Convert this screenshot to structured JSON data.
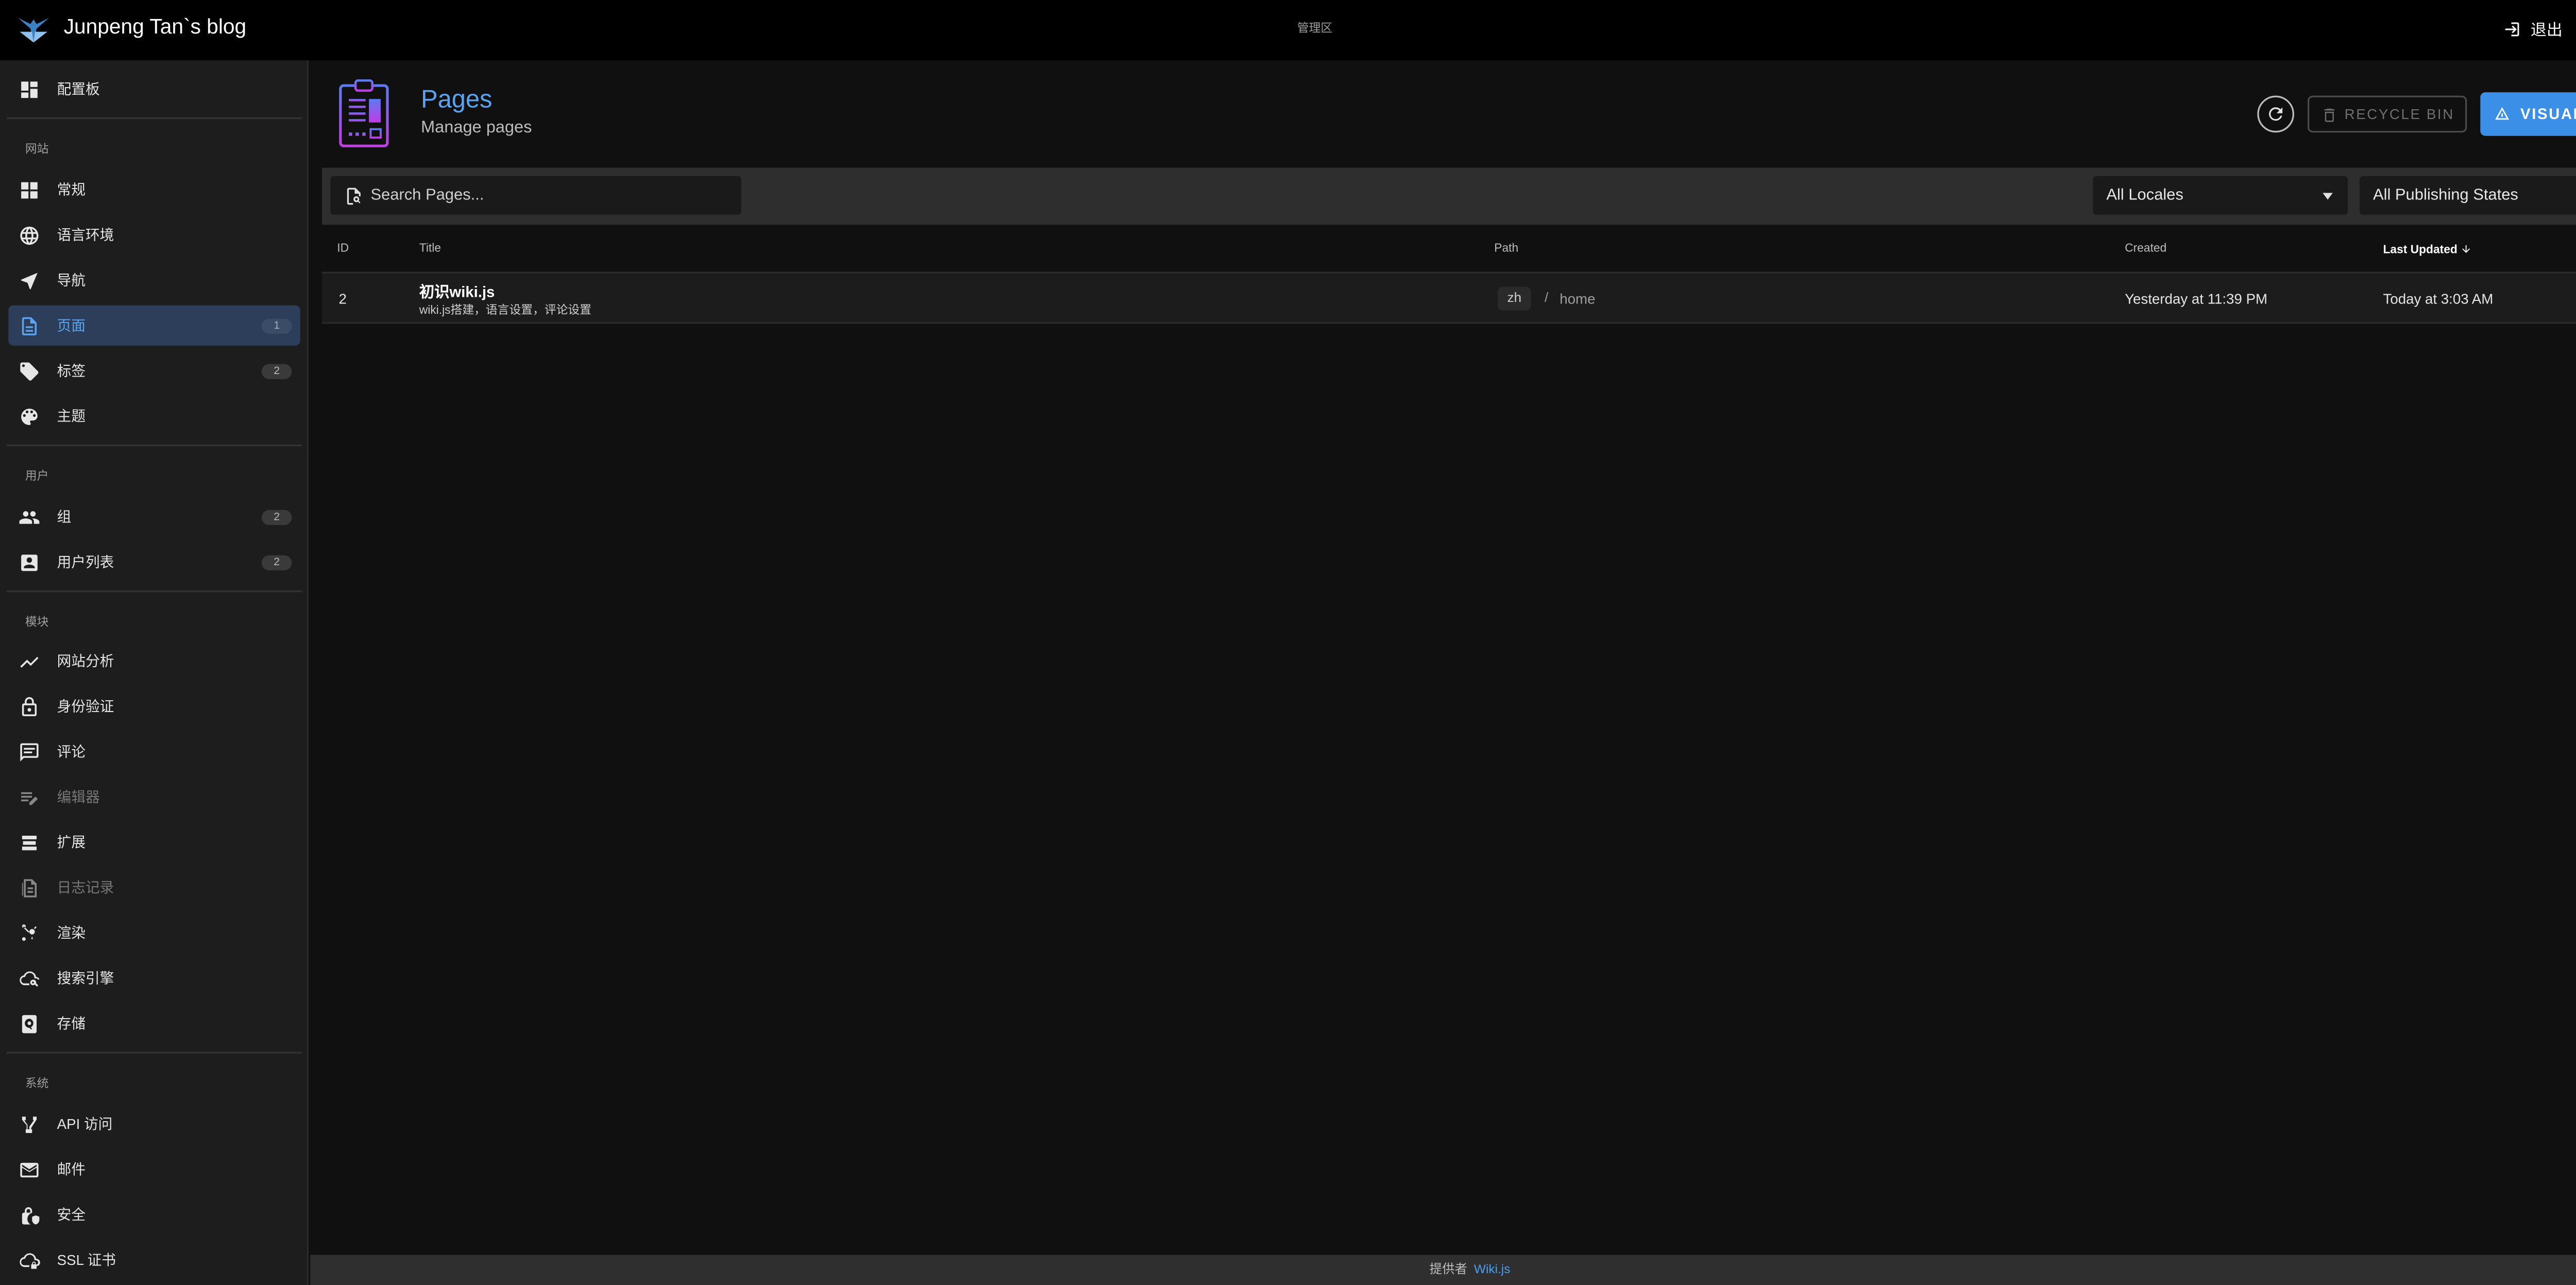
{
  "header": {
    "brand": "Junpeng Tan`s blog",
    "admin_area": "管理区",
    "logout": "退出"
  },
  "sidebar": {
    "dashboard": "配置板",
    "sections": {
      "site": "网站",
      "users": "用户",
      "modules": "模块",
      "system": "系统"
    },
    "items": [
      {
        "label": "常规",
        "icon": "dashboard-icon"
      },
      {
        "label": "语言环境",
        "icon": "globe-icon"
      },
      {
        "label": "导航",
        "icon": "navigation-icon"
      },
      {
        "label": "页面",
        "icon": "page-icon",
        "count": "1"
      },
      {
        "label": "标签",
        "icon": "tags-icon",
        "count": "2"
      },
      {
        "label": "主题",
        "icon": "palette-icon"
      },
      {
        "label": "组",
        "icon": "group-icon",
        "count": "2"
      },
      {
        "label": "用户列表",
        "icon": "user-list-icon",
        "count": "2"
      },
      {
        "label": "网站分析",
        "icon": "analytics-icon"
      },
      {
        "label": "身份验证",
        "icon": "lock-icon"
      },
      {
        "label": "评论",
        "icon": "comment-icon"
      },
      {
        "label": "编辑器",
        "icon": "editor-icon"
      },
      {
        "label": "扩展",
        "icon": "extension-icon"
      },
      {
        "label": "日志记录",
        "icon": "log-icon"
      },
      {
        "label": "渲染",
        "icon": "render-icon"
      },
      {
        "label": "搜索引擎",
        "icon": "search-engine-icon"
      },
      {
        "label": "存储",
        "icon": "storage-icon"
      },
      {
        "label": "API 访问",
        "icon": "api-icon"
      },
      {
        "label": "邮件",
        "icon": "mail-icon"
      },
      {
        "label": "安全",
        "icon": "security-icon"
      },
      {
        "label": "SSL 证书",
        "icon": "ssl-icon"
      }
    ]
  },
  "page": {
    "title": "Pages",
    "subtitle": "Manage pages",
    "recycle_bin": "RECYCLE BIN",
    "visualize": "VISUALIZE"
  },
  "toolbar": {
    "search_placeholder": "Search Pages...",
    "locale_select": "All Locales",
    "publish_select": "All Publishing States"
  },
  "table": {
    "columns": [
      "ID",
      "Title",
      "Path",
      "Created",
      "Last Updated"
    ],
    "rows": [
      {
        "id": "2",
        "title": "初识wiki.js",
        "description": "wiki.js搭建，语言设置，评论设置",
        "locale": "zh",
        "path": "home",
        "created": "Yesterday at 11:39 PM",
        "updated": "Today at 3:03 AM"
      }
    ]
  },
  "footer": {
    "powered_by": "提供者",
    "link": "Wiki.js"
  },
  "colors": {
    "accent": "#5aa3f0",
    "button_primary": "#3b8fe6",
    "active_nav_bg": "#2c3e59"
  }
}
